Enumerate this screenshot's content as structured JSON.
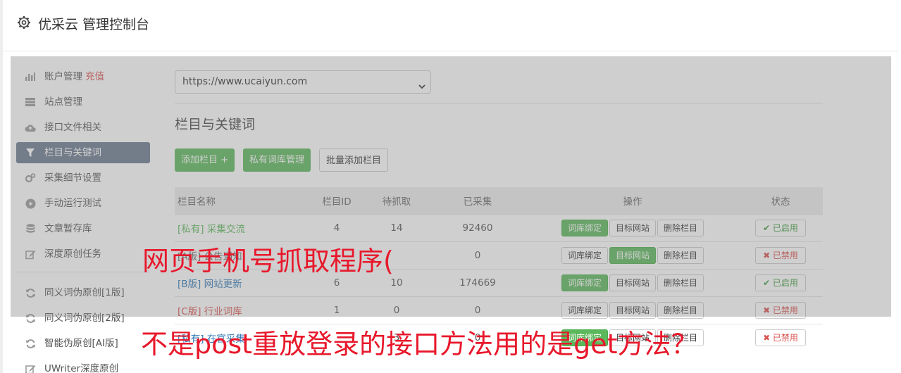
{
  "header": {
    "title": "优采云 管理控制台",
    "icon": "gear-icon"
  },
  "sidebar": {
    "items": [
      {
        "label": "账户管理",
        "badge": "充值",
        "icon": "bar-chart-icon"
      },
      {
        "label": "站点管理",
        "icon": "server-icon"
      },
      {
        "label": "接口文件相关",
        "icon": "cloud-upload-icon"
      },
      {
        "label": "栏目与关键词",
        "icon": "filter-icon",
        "active": true
      },
      {
        "label": "采集细节设置",
        "icon": "cogs-icon"
      },
      {
        "label": "手动运行测试",
        "icon": "play-circle-icon"
      },
      {
        "label": "文章暂存库",
        "icon": "database-icon"
      },
      {
        "label": "深度原创任务",
        "icon": "edit-icon"
      },
      {
        "label": "同义词伪原创[1版]",
        "icon": "refresh-icon"
      },
      {
        "label": "同义词伪原创[2版]",
        "icon": "refresh-icon"
      },
      {
        "label": "智能伪原创[AI版]",
        "icon": "refresh-icon"
      },
      {
        "label": "UWriter深度原创",
        "icon": "edit-icon"
      }
    ]
  },
  "main": {
    "site_select": {
      "value": "https://www.ucaiyun.com"
    },
    "section_title": "栏目与关键词",
    "buttons": {
      "add_column": "添加栏目 +",
      "private_dict": "私有词库管理",
      "batch_add": "批量添加栏目"
    },
    "table": {
      "headers": [
        "栏目名称",
        "栏目ID",
        "待抓取",
        "已采集",
        "操作",
        "状态"
      ],
      "op_labels": {
        "bind": "词库绑定",
        "target": "目标网站",
        "delete": "删除栏目"
      },
      "rows": [
        {
          "tag": "[私有]",
          "name": "采集交流",
          "id": "4",
          "pending": "14",
          "collected": "92460",
          "bind_on": true,
          "target_on": false,
          "status": "✔ 已启用"
        },
        {
          "tag": "[A版]",
          "name": "公告通知",
          "id": "",
          "pending": "",
          "collected": "0",
          "bind_on": false,
          "target_on": true,
          "status": "✖ 已禁用"
        },
        {
          "tag": "[B版]",
          "name": "网站更新",
          "id": "6",
          "pending": "10",
          "collected": "174669",
          "bind_on": true,
          "target_on": false,
          "status": "✔ 已启用"
        },
        {
          "tag": "[C版]",
          "name": "行业词库",
          "id": "1",
          "pending": "0",
          "collected": "0",
          "bind_on": false,
          "target_on": false,
          "status": "✖ 已禁用"
        },
        {
          "tag": "[私有]",
          "name": "在官采集",
          "id": "",
          "pending": "3",
          "collected": "0",
          "bind_on": true,
          "target_on": false,
          "status": "✖ 已禁用"
        }
      ]
    }
  },
  "captions": {
    "line1": "网页手机号抓取程序(",
    "line2": "不是post重放登录的接口方法用的是get方法？"
  }
}
